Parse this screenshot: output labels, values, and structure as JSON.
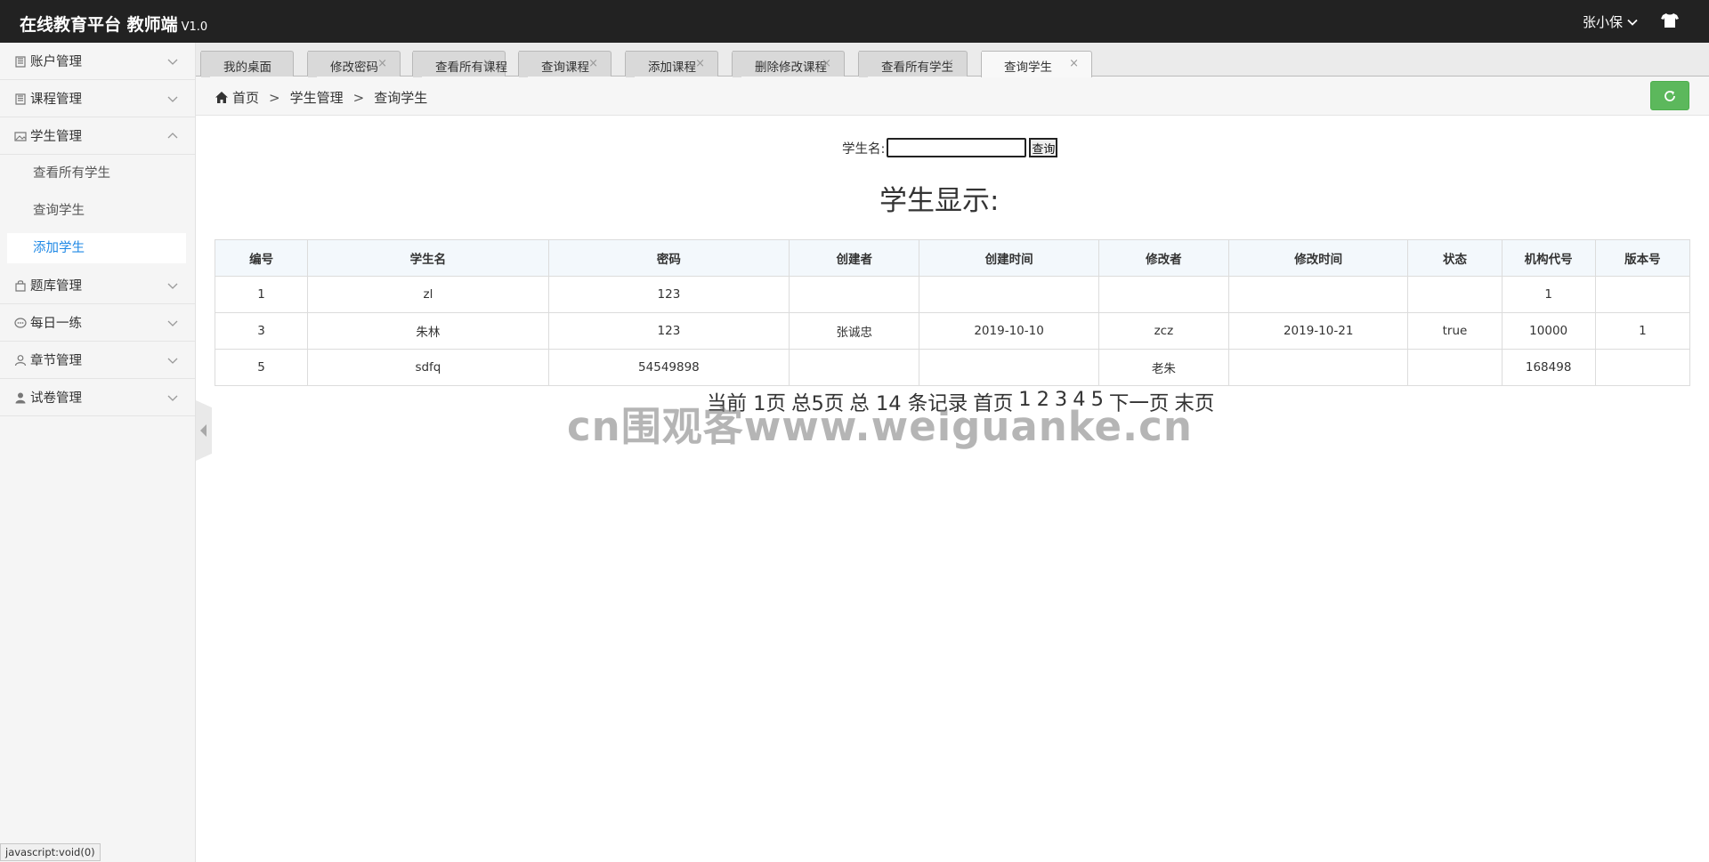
{
  "header": {
    "brand_title": "在线教育平台 教师端",
    "brand_version": "V1.0",
    "user_name": "张小保",
    "icons": {
      "user_dropdown": "chevron-down-icon",
      "theme": "tshirt-icon"
    }
  },
  "sidebar": {
    "menus": [
      {
        "label": "账户管理",
        "icon": "book-icon",
        "expanded": false
      },
      {
        "label": "课程管理",
        "icon": "book-icon",
        "expanded": false
      },
      {
        "label": "学生管理",
        "icon": "picture-icon",
        "expanded": true,
        "items": [
          {
            "label": "查看所有学生",
            "active": false
          },
          {
            "label": "查询学生",
            "active": false
          },
          {
            "label": "添加学生",
            "active": true
          }
        ]
      },
      {
        "label": "题库管理",
        "icon": "bag-icon",
        "expanded": false
      },
      {
        "label": "每日一练",
        "icon": "chat-icon",
        "expanded": false
      },
      {
        "label": "章节管理",
        "icon": "user-outline-icon",
        "expanded": false
      },
      {
        "label": "试卷管理",
        "icon": "user-icon",
        "expanded": false
      }
    ],
    "status_text": "javascript:void(0)"
  },
  "tabs": [
    {
      "label": "我的桌面",
      "closable": false,
      "active": false
    },
    {
      "label": "修改密码",
      "closable": true,
      "active": false
    },
    {
      "label": "查看所有课程",
      "closable": true,
      "active": false
    },
    {
      "label": "查询课程",
      "closable": true,
      "active": false
    },
    {
      "label": "添加课程",
      "closable": true,
      "active": false
    },
    {
      "label": "删除修改课程",
      "closable": true,
      "active": false
    },
    {
      "label": "查看所有学生",
      "closable": true,
      "active": false
    },
    {
      "label": "查询学生",
      "closable": true,
      "active": true
    }
  ],
  "tab_close_glyph": "×",
  "breadcrumb": {
    "items": [
      "首页",
      "学生管理",
      "查询学生"
    ],
    "separator": ">"
  },
  "colors": {
    "refresh_button": "#5cb85c",
    "active_link": "#1e88e5",
    "header": "#222222"
  },
  "search": {
    "label": "学生名:",
    "value": "",
    "placeholder": "",
    "button_label": "查询"
  },
  "page_title": "学生显示:",
  "table": {
    "columns": [
      "编号",
      "学生名",
      "密码",
      "创建者",
      "创建时间",
      "修改者",
      "修改时间",
      "状态",
      "机构代号",
      "版本号"
    ],
    "rows": [
      [
        "1",
        "zl",
        "123",
        "",
        "",
        "",
        "",
        "",
        "1",
        ""
      ],
      [
        "3",
        "朱林",
        "123",
        "张诚忠",
        "2019-10-10",
        "zcz",
        "2019-10-21",
        "true",
        "10000",
        "1"
      ],
      [
        "5",
        "sdfq",
        "54549898",
        "",
        "",
        "老朱",
        "",
        "",
        "168498",
        ""
      ]
    ]
  },
  "pager": {
    "current": "当前 1页",
    "total_pages": "总5页",
    "total_records": "总 14 条记录",
    "first": "首页",
    "pages": [
      "1",
      "2",
      "3",
      "4",
      "5"
    ],
    "next": "下一页",
    "last": "末页"
  },
  "watermark": "cn围观客www.weiguanke.cn"
}
